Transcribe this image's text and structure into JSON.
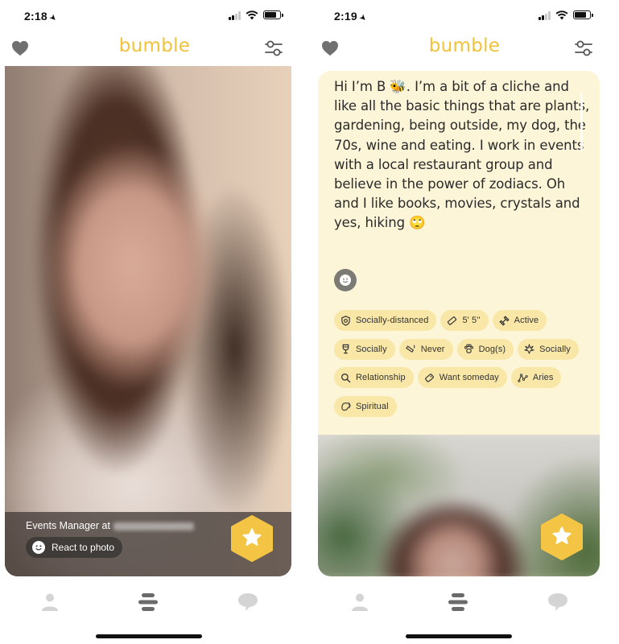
{
  "screens": [
    {
      "status_bar": {
        "time": "2:18",
        "location_icon": "location-arrow-icon",
        "signal_bars": 2,
        "battery_level": 0.78
      },
      "header": {
        "title": "bumble",
        "left_icon": "heart-icon",
        "right_icon": "filter-sliders-icon"
      },
      "card": {
        "type": "photo",
        "job_title": "Events Manager at",
        "company": "Restaurant Group (blurred)",
        "react_button_label": "React to photo",
        "superswipe_icon": "star-hexagon-icon"
      },
      "tab_bar": {
        "items": [
          {
            "name": "profile",
            "icon": "person-icon",
            "active": false
          },
          {
            "name": "encounters",
            "icon": "stack-icon",
            "active": true
          },
          {
            "name": "chats",
            "icon": "chat-bubble-icon",
            "active": false
          }
        ]
      }
    },
    {
      "status_bar": {
        "time": "2:19",
        "location_icon": "location-arrow-icon",
        "signal_bars": 2,
        "battery_level": 0.78
      },
      "header": {
        "title": "bumble",
        "left_icon": "heart-icon",
        "right_icon": "filter-sliders-icon"
      },
      "card": {
        "type": "bio",
        "bio_before_emoji": "Hi I’m B ",
        "bio_emoji_1": "🐝",
        "bio_after_emoji": ". I’m a bit of a cliche and like all the basic things that are plants, gardening, being outside, my dog, the 70s, wine and eating. I work in events with a local restaurant group and believe in the power of zodiacs. Oh and I like books, movies, crystals and yes, hiking ",
        "bio_emoji_2": "🙄",
        "react_icon": "smile-icon",
        "badges": [
          {
            "icon": "shield-virus-icon",
            "label": "Socially-distanced"
          },
          {
            "icon": "ruler-icon",
            "label": "5' 5''"
          },
          {
            "icon": "dumbbell-icon",
            "label": "Active"
          },
          {
            "icon": "wine-glass-icon",
            "label": "Socially"
          },
          {
            "icon": "cigarette-icon",
            "label": "Never"
          },
          {
            "icon": "paw-icon",
            "label": "Dog(s)"
          },
          {
            "icon": "cannabis-leaf-icon",
            "label": "Socially"
          },
          {
            "icon": "magnifier-icon",
            "label": "Relationship"
          },
          {
            "icon": "pacifier-tag-icon",
            "label": "Want someday"
          },
          {
            "icon": "constellation-icon",
            "label": "Aries"
          },
          {
            "icon": "praying-hands-icon",
            "label": "Spiritual"
          }
        ],
        "superswipe_icon": "star-hexagon-icon"
      },
      "tab_bar": {
        "items": [
          {
            "name": "profile",
            "icon": "person-icon",
            "active": false
          },
          {
            "name": "encounters",
            "icon": "stack-icon",
            "active": true
          },
          {
            "name": "chats",
            "icon": "chat-bubble-icon",
            "active": false
          }
        ]
      }
    }
  ],
  "colors": {
    "brand_yellow": "#f2c23a",
    "bio_background": "#fdf5d8",
    "badge_background": "#f9e7a8",
    "icon_gray": "#6e6e6e",
    "tab_inactive": "#d4d4d4"
  }
}
